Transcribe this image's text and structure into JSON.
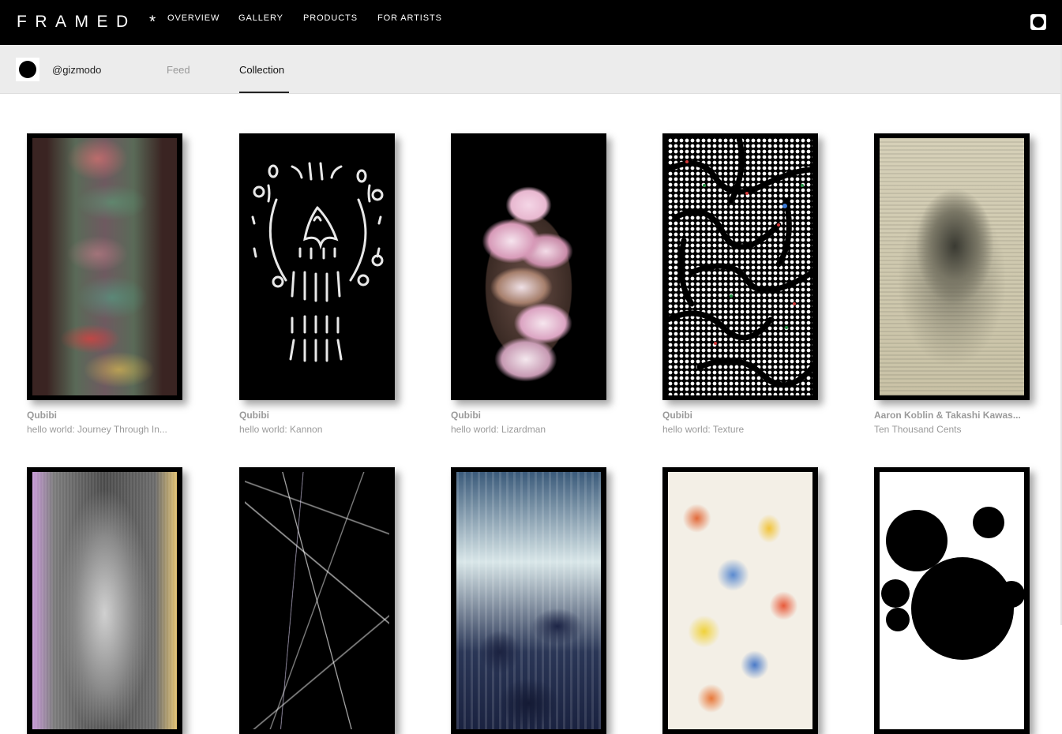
{
  "brand": {
    "logo": "FRAMED *"
  },
  "nav": {
    "items": [
      {
        "label": "OVERVIEW"
      },
      {
        "label": "GALLERY"
      },
      {
        "label": "PRODUCTS"
      },
      {
        "label": "FOR ARTISTS"
      }
    ],
    "user_icon": "account-icon"
  },
  "profile": {
    "username": "@gizmodo",
    "tabs": [
      {
        "label": "Feed",
        "active": false
      },
      {
        "label": "Collection",
        "active": true
      }
    ]
  },
  "collection": {
    "row1": [
      {
        "artist": "Qubibi",
        "title": "hello world: Journey Through In..."
      },
      {
        "artist": "Qubibi",
        "title": "hello world: Kannon"
      },
      {
        "artist": "Qubibi",
        "title": "hello world: Lizardman"
      },
      {
        "artist": "Qubibi",
        "title": "hello world: Texture"
      },
      {
        "artist": "Aaron Koblin & Takashi Kawas...",
        "title": "Ten Thousand Cents"
      }
    ],
    "row2_count_visible": 5
  },
  "colors": {
    "topbar_bg": "#000000",
    "subbar_bg": "#ececec",
    "muted_text": "#9a9a9a"
  }
}
